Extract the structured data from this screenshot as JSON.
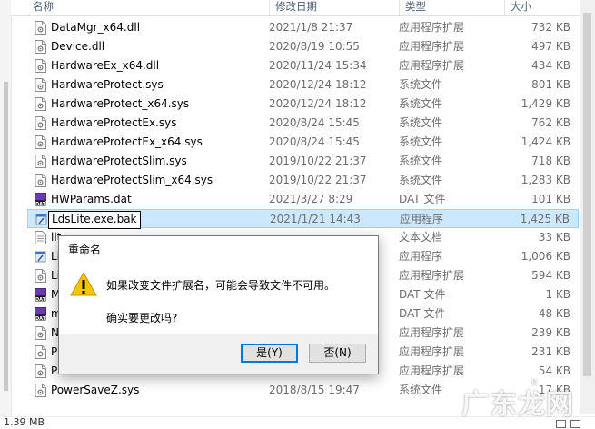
{
  "header": {
    "name": "名称",
    "date": "修改日期",
    "type": "类型",
    "size": "大小"
  },
  "files": [
    {
      "name": "DataMgr_x64.dll",
      "date": "2021/1/8 21:37",
      "type": "应用程序扩展",
      "size": "732 KB",
      "icon": "dll-file-icon"
    },
    {
      "name": "Device.dll",
      "date": "2020/8/19 10:55",
      "type": "应用程序扩展",
      "size": "497 KB",
      "icon": "dll-file-icon"
    },
    {
      "name": "HardwareEx_x64.dll",
      "date": "2020/11/24 15:34",
      "type": "应用程序扩展",
      "size": "434 KB",
      "icon": "dll-file-icon"
    },
    {
      "name": "HardwareProtect.sys",
      "date": "2020/12/24 18:12",
      "type": "系统文件",
      "size": "801 KB",
      "icon": "sys-file-icon"
    },
    {
      "name": "HardwareProtect_x64.sys",
      "date": "2020/12/24 18:12",
      "type": "系统文件",
      "size": "1,429 KB",
      "icon": "sys-file-icon"
    },
    {
      "name": "HardwareProtectEx.sys",
      "date": "2020/8/24 15:45",
      "type": "系统文件",
      "size": "762 KB",
      "icon": "sys-file-icon"
    },
    {
      "name": "HardwareProtectEx_x64.sys",
      "date": "2020/8/24 15:45",
      "type": "系统文件",
      "size": "1,424 KB",
      "icon": "sys-file-icon"
    },
    {
      "name": "HardwareProtectSlim.sys",
      "date": "2019/10/22 21:37",
      "type": "系统文件",
      "size": "718 KB",
      "icon": "sys-file-icon"
    },
    {
      "name": "HardwareProtectSlim_x64.sys",
      "date": "2019/10/22 21:37",
      "type": "系统文件",
      "size": "1,283 KB",
      "icon": "sys-file-icon"
    },
    {
      "name": "HWParams.dat",
      "date": "2021/3/27 8:29",
      "type": "DAT 文件",
      "size": "101 KB",
      "icon": "dat-file-icon"
    },
    {
      "name": "LdsLite.exe.bak",
      "date": "2021/1/21 14:43",
      "type": "应用程序",
      "size": "1,425 KB",
      "icon": "exe-file-icon",
      "editing": true
    },
    {
      "name": "lit",
      "date": "",
      "type": "文本文档",
      "size": "33 KB",
      "icon": "txt-file-icon"
    },
    {
      "name": "Li",
      "date": "",
      "type": "应用程序",
      "size": "1,006 KB",
      "icon": "exe-file-icon"
    },
    {
      "name": "Li",
      "date": "",
      "type": "应用程序扩展",
      "size": "594 KB",
      "icon": "dll-file-icon"
    },
    {
      "name": "M",
      "date": "",
      "type": "DAT 文件",
      "size": "1 KB",
      "icon": "dat-file-icon"
    },
    {
      "name": "m",
      "date": "",
      "type": "DAT 文件",
      "size": "48 KB",
      "icon": "dat-file-icon"
    },
    {
      "name": "N",
      "date": "",
      "type": "应用程序扩展",
      "size": "239 KB",
      "icon": "dll-file-icon"
    },
    {
      "name": "Pl",
      "date": "",
      "type": "应用程序扩展",
      "size": "231 KB",
      "icon": "dll-file-icon"
    },
    {
      "name": "Pl",
      "date": "",
      "type": "应用程序扩展",
      "size": "54 KB",
      "icon": "dll-file-icon"
    },
    {
      "name": "PowerSaveZ.sys",
      "date": "2018/8/15 19:47",
      "type": "系统文件",
      "size": "17 KB",
      "icon": "sys-file-icon"
    }
  ],
  "status": {
    "text": "1.39 MB"
  },
  "dialog": {
    "title": "重命名",
    "message": "如果改变文件扩展名，可能会导致文件不可用。",
    "question": "确实要更改吗?",
    "yes_label": "是(Y)",
    "no_label": "否(N)",
    "icon": "warning-icon"
  },
  "watermark": {
    "text": "广东龙网",
    "small": "K"
  }
}
